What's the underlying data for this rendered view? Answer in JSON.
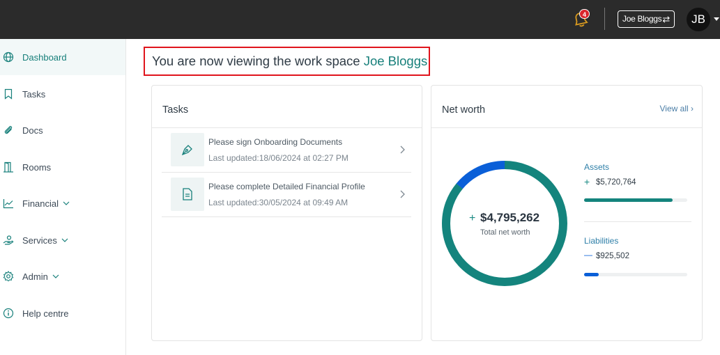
{
  "header": {
    "notification_count": "4",
    "user_switch_label": "Joe Bloggs",
    "avatar_initials": "JB"
  },
  "sidebar": {
    "items": [
      {
        "label": "Dashboard",
        "icon": "globe-icon"
      },
      {
        "label": "Tasks",
        "icon": "bookmark-icon"
      },
      {
        "label": "Docs",
        "icon": "paperclip-icon"
      },
      {
        "label": "Rooms",
        "icon": "door-icon"
      },
      {
        "label": "Financial",
        "icon": "chart-line-icon"
      },
      {
        "label": "Services",
        "icon": "hand-icon"
      },
      {
        "label": "Admin",
        "icon": "gear-icon"
      },
      {
        "label": "Help centre",
        "icon": "info-icon"
      }
    ]
  },
  "banner": {
    "prefix": "You are now viewing the work space ",
    "workspace_name": "Joe Bloggs"
  },
  "tasks_card": {
    "title": "Tasks",
    "items": [
      {
        "title": "Please sign Onboarding Documents",
        "updated": "Last updated:18/06/2024 at 02:27 PM",
        "icon": "pen-nib-icon"
      },
      {
        "title": "Please complete Detailed Financial Profile",
        "updated": "Last updated:30/05/2024 at 09:49 AM",
        "icon": "document-icon"
      }
    ]
  },
  "networth_card": {
    "title": "Net worth",
    "view_all": "View all",
    "total_sign": "+",
    "total_value": "$4,795,262",
    "total_label": "Total net worth",
    "assets_label": "Assets",
    "assets_sign": "+",
    "assets_value": "$5,720,764",
    "assets_fraction": 0.86,
    "liabilities_label": "Liabilities",
    "liabilities_sign": "—",
    "liabilities_value": "$925,502",
    "liabilities_fraction": 0.14,
    "colors": {
      "assets": "#14847d",
      "liabilities": "#0a5fd8"
    }
  }
}
